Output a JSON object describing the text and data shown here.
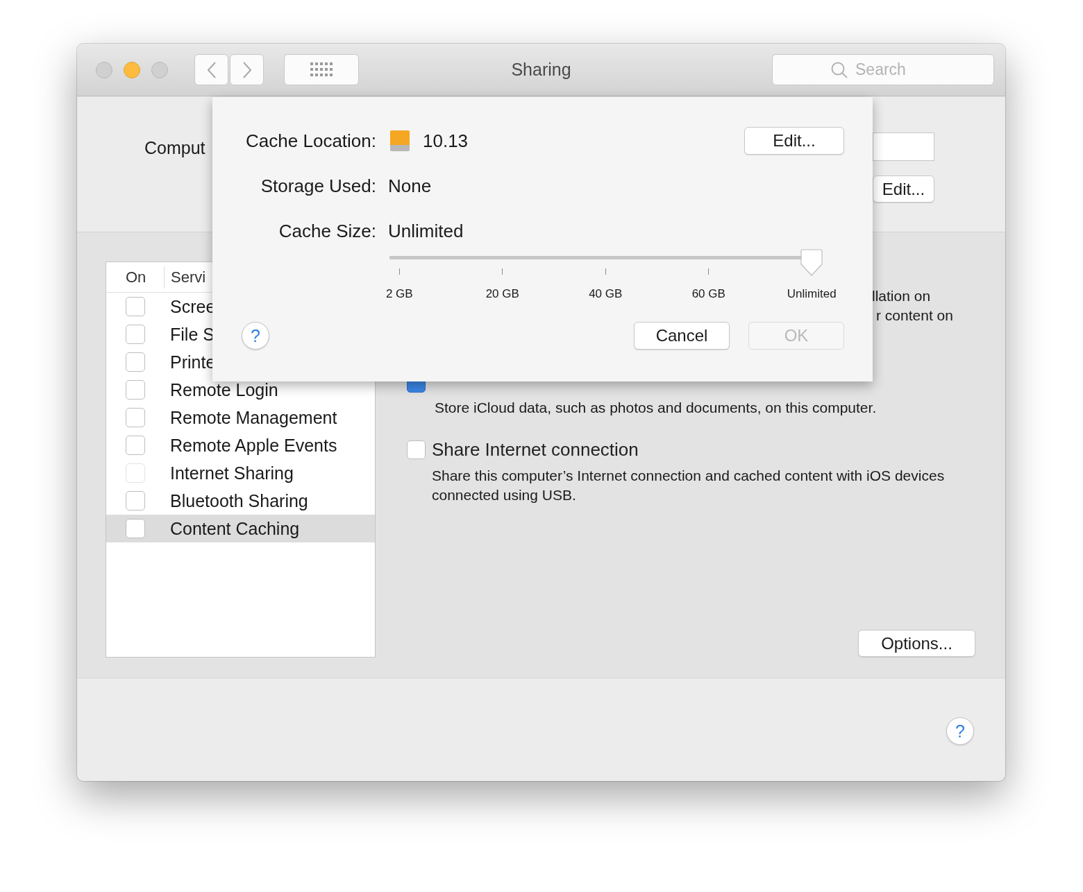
{
  "window": {
    "title": "Sharing"
  },
  "toolbar": {
    "search": {
      "placeholder": "Search"
    }
  },
  "computer_name": {
    "label": "Comput",
    "edit_button": "Edit..."
  },
  "services": {
    "columns": [
      "On",
      "Servi"
    ],
    "rows": [
      {
        "name": "Scree",
        "checked": false,
        "disabled": false,
        "selected": false
      },
      {
        "name": "File S",
        "checked": false,
        "disabled": false,
        "selected": false
      },
      {
        "name": "Printe",
        "checked": false,
        "disabled": false,
        "selected": false
      },
      {
        "name": "Remote Login",
        "checked": false,
        "disabled": false,
        "selected": false
      },
      {
        "name": "Remote Management",
        "checked": false,
        "disabled": false,
        "selected": false
      },
      {
        "name": "Remote Apple Events",
        "checked": false,
        "disabled": false,
        "selected": false
      },
      {
        "name": "Internet Sharing",
        "checked": false,
        "disabled": true,
        "selected": false
      },
      {
        "name": "Bluetooth Sharing",
        "checked": false,
        "disabled": false,
        "selected": false
      },
      {
        "name": "Content Caching",
        "checked": false,
        "disabled": false,
        "selected": true
      }
    ]
  },
  "details": {
    "description_lines": [
      "llation on",
      "r content on"
    ],
    "cache_icloud": {
      "checked": true,
      "description": "Store iCloud data, such as photos and documents, on this computer."
    },
    "share_internet": {
      "checked": false,
      "label": "Share Internet connection",
      "description": "Share this computer’s Internet connection and cached content with iOS devices connected using USB."
    },
    "options_button": "Options..."
  },
  "help_button": "?",
  "sheet": {
    "rows": [
      {
        "kind": "location",
        "label": "Cache Location:",
        "value": "10.13",
        "button": "Edit..."
      },
      {
        "kind": "text",
        "label": "Storage Used:",
        "value": "None"
      },
      {
        "kind": "text",
        "label": "Cache Size:",
        "value": "Unlimited"
      }
    ],
    "slider": {
      "level": 1,
      "ticks": [
        "2 GB",
        "20 GB",
        "40 GB",
        "60 GB",
        "Unlimited"
      ]
    },
    "help_button": "?",
    "buttons": [
      {
        "label": "Cancel",
        "disabled": false
      },
      {
        "label": "OK",
        "disabled": true
      }
    ]
  }
}
